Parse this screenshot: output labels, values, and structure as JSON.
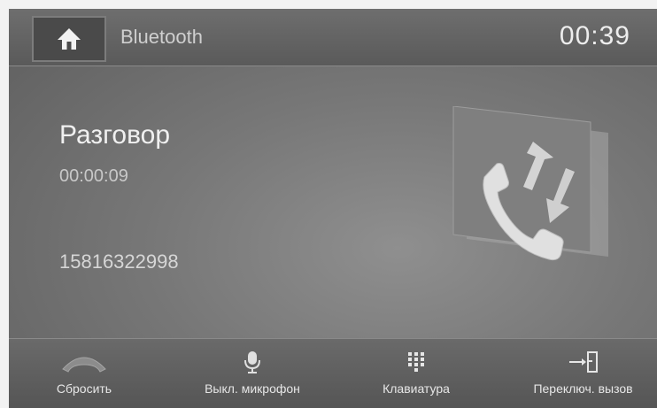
{
  "header": {
    "title": "Bluetooth",
    "clock": "00:39",
    "home_icon": "home-icon"
  },
  "call": {
    "status": "Разговор",
    "duration": "00:00:09",
    "number": "15816322998",
    "graphic_icon": "call-switch-icon"
  },
  "bottom_bar": {
    "items": [
      {
        "label": "Сбросить",
        "icon": "hang-up-icon"
      },
      {
        "label": "Выкл. микрофон",
        "icon": "microphone-icon"
      },
      {
        "label": "Клавиатура",
        "icon": "keypad-icon"
      },
      {
        "label": "Переключ. вызов",
        "icon": "switch-call-icon"
      }
    ]
  }
}
